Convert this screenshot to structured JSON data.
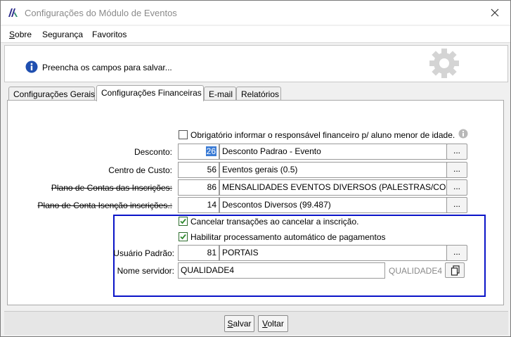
{
  "window": {
    "title": "Configurações do Módulo de Eventos"
  },
  "menu": {
    "items": [
      {
        "label_first": "S",
        "label_rest": "obre"
      },
      {
        "label": "Segurança"
      },
      {
        "label": "Favoritos"
      }
    ]
  },
  "info": {
    "message": "Preencha os campos para salvar..."
  },
  "tabs": [
    {
      "label": "Configurações Gerais",
      "active": false
    },
    {
      "label": "Configurações Financeiras",
      "active": true
    },
    {
      "label": "E-mail",
      "active": false
    },
    {
      "label": "Relatórios",
      "active": false
    }
  ],
  "form": {
    "obrigatorio_label": "Obrigatório informar o responsável financeiro p/ aluno menor de idade.",
    "obrigatorio_checked": false,
    "desconto": {
      "label": "Desconto:",
      "code_selected": "26",
      "description": "Desconto Padrao - Evento",
      "button": "..."
    },
    "centro_custo": {
      "label": "Centro de Custo:",
      "code": "56",
      "description": "Eventos gerais (0.5)",
      "button": "..."
    },
    "plano_contas": {
      "label": "Plano de Contas das Inscrições:",
      "code": "86",
      "description": "MENSALIDADES EVENTOS DIVERSOS (PALESTRAS/CONGRES",
      "button": "..."
    },
    "plano_isencao": {
      "label": "Plano de Conta Isenção inscrições.:",
      "code": "14",
      "description": "Descontos Diversos (99.487)",
      "button": "..."
    },
    "cancelar_label": "Cancelar transações ao cancelar a inscrição.",
    "cancelar_checked": true,
    "habilitar_label": "Habilitar processamento automático de pagamentos",
    "habilitar_checked": true,
    "usuario": {
      "label": "Usuário Padrão:",
      "code": "81",
      "description": "PORTAIS",
      "button": "..."
    },
    "servidor": {
      "label": "Nome servidor:",
      "value": "QUALIDADE4",
      "hint": "QUALIDADE4"
    }
  },
  "buttons": {
    "salvar": {
      "first": "S",
      "rest": "alvar"
    },
    "voltar": {
      "first": "V",
      "rest": "oltar"
    }
  },
  "colors": {
    "highlight_frame": "#0a14c8",
    "selection": "#3a7bd5"
  }
}
